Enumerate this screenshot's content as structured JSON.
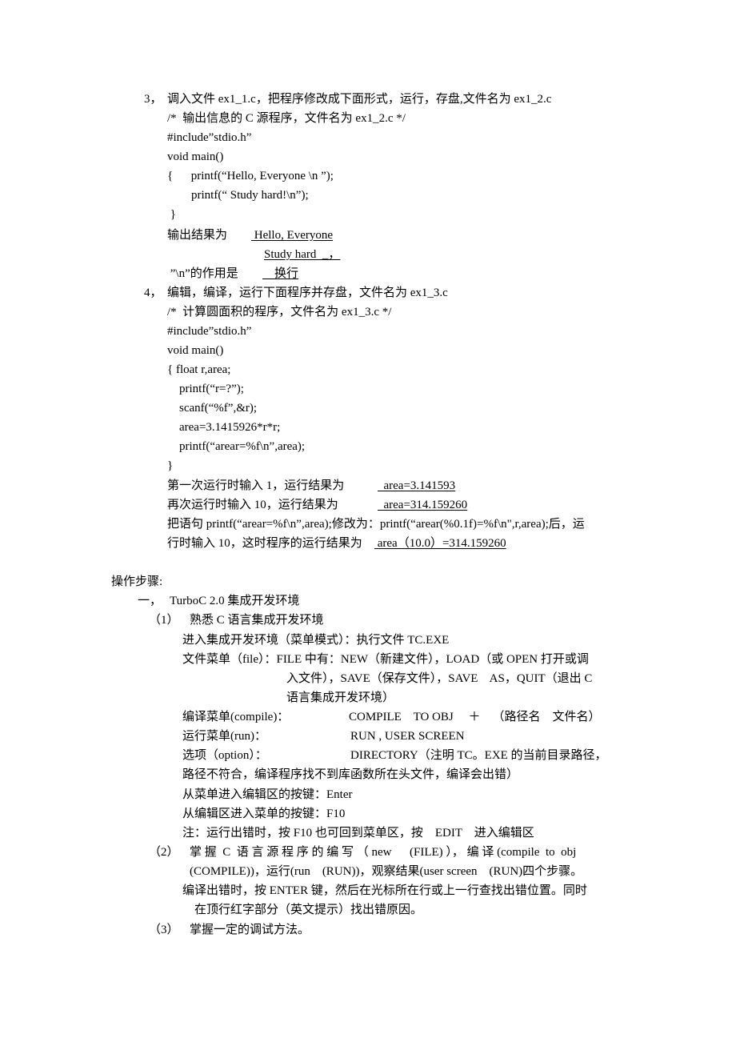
{
  "section3": {
    "num": "3，",
    "instruction": "调入文件 ex1_1.c，把程序修改成下面形式，运行，存盘,文件名为 ex1_2.c",
    "code": [
      "/*  输出信息的 C 源程序，文件名为 ex1_2.c */",
      "#include”stdio.h”",
      "void main()",
      "{      printf(“Hello, Everyone \\n ”);",
      "        printf(“ Study hard!\\n”);",
      " }"
    ],
    "output_label": "输出结果为",
    "output_line1": " Hello, Everyone",
    "output_line2": "Study hard  _，",
    "newline_label": " ”\\n”的作用是",
    "newline_answer": "    换行"
  },
  "section4": {
    "num": "4，",
    "instruction": "编辑，编译，运行下面程序并存盘，文件名为 ex1_3.c",
    "code": [
      "/*  计算圆面积的程序，文件名为 ex1_3.c */",
      "#include”stdio.h”",
      "void main()",
      "{ float r,area;",
      "    printf(“r=?”);",
      "    scanf(“%f”,&r);",
      "    area=3.1415926*r*r;",
      "    printf(“arear=%f\\n”,area);",
      "}"
    ],
    "run1_label": "第一次运行时输入 1，运行结果为",
    "run1_answer": "  area=3.141593",
    "run2_label": "再次运行时输入 10，运行结果为",
    "run2_answer": "  area=314.159260",
    "modify_line1": "把语句 printf(“arear=%f\\n”,area);修改为：printf(“arear(%0.1f)=%f\\n\",r,area);后，运",
    "modify_line2_label": "行时输入 10，这时程序的运行结果为",
    "modify_line2_answer": " area（10.0）=314.159260"
  },
  "steps": {
    "heading": "操作步骤:",
    "part1_num": "一，",
    "part1_title": "TurboC 2.0 集成开发环境",
    "item1_num": "（1）",
    "item1_title": "熟悉 C 语言集成开发环境",
    "item1_lines": {
      "enter_env": "进入集成开发环境（菜单模式）：执行文件 TC.EXE",
      "file_menu_a": "文件菜单（file）：FILE 中有：NEW（新建文件），LOAD（或 OPEN 打开或调",
      "file_menu_b": "入文件），SAVE（保存文件），SAVE    AS，QUIT（退出 C",
      "file_menu_c": "语言集成开发环境）",
      "compile_label": "编译菜单(compile)：",
      "compile_value": "COMPILE    TO OBJ     ＋    （路径名    文件名）",
      "run_label": "运行菜单(run)：",
      "run_value": "RUN , USER SCREEN",
      "option_label": "选项（option）：",
      "option_value": "DIRECTORY（注明 TC。EXE 的当前目录路径，",
      "option_cont": "路径不符合，编译程序找不到库函数所在头文件，编译会出错）",
      "menu_to_edit": "从菜单进入编辑区的按键：Enter",
      "edit_to_menu": "从编辑区进入菜单的按键：F10",
      "note": "注：运行出错时，按 F10 也可回到菜单区，按    EDIT    进入编辑区"
    },
    "item2_num": "（2）",
    "item2_line1": "掌 握  C  语 言 源 程 序 的 编 写 （ new      (FILE) ）， 编 译 (compile  to  obj",
    "item2_line2": "(COMPILE))，运行(run    (RUN))，观察结果(user screen    (RUN)四个步骤。",
    "item2_line3": "编译出错时，按 ENTER 键，然后在光标所在行或上一行查找出错位置。同时",
    "item2_line4": "在顶行红字部分（英文提示）找出错原因。",
    "item3_num": "（3）",
    "item3_title": "掌握一定的调试方法。"
  }
}
